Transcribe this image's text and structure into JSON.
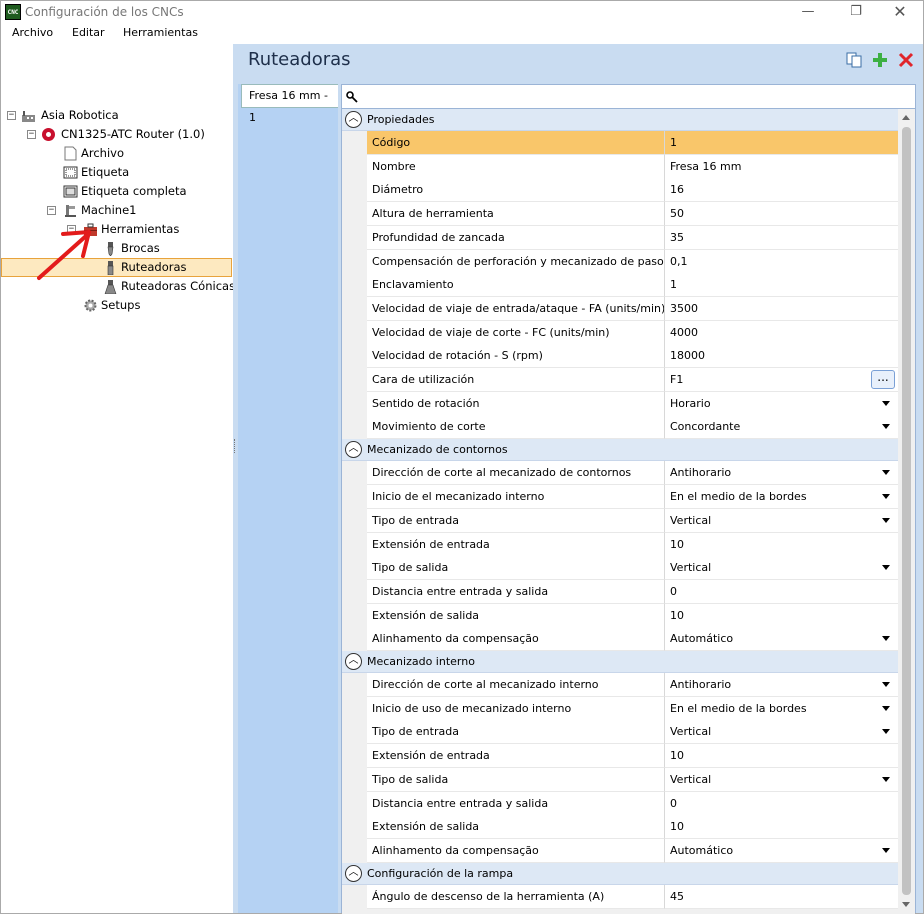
{
  "window": {
    "title": "Configuración de los CNCs",
    "app_icon_text": "CNC"
  },
  "menu": [
    "Archivo",
    "Editar",
    "Herramientas"
  ],
  "tree": [
    {
      "label": "Asia Robotica",
      "expander": "−",
      "icon": "factory-icon"
    },
    {
      "label": "CN1325-ATC Router (1.0)",
      "expander": "−",
      "icon": "router-machine-icon"
    },
    {
      "label": "Archivo",
      "icon": "file-icon"
    },
    {
      "label": "Etiqueta",
      "icon": "label-icon"
    },
    {
      "label": "Etiqueta completa",
      "icon": "label-full-icon"
    },
    {
      "label": "Machine1",
      "expander": "−",
      "icon": "machine-icon"
    },
    {
      "label": "Herramientas",
      "expander": "−",
      "icon": "toolbox-icon"
    },
    {
      "label": "Brocas",
      "icon": "drill-bit-icon"
    },
    {
      "label": "Ruteadoras",
      "icon": "router-bit-icon",
      "selected": true
    },
    {
      "label": "Ruteadoras Cónicas",
      "icon": "conical-bit-icon"
    },
    {
      "label": "Setups",
      "icon": "gear-icon"
    }
  ],
  "main": {
    "title": "Ruteadoras",
    "tab": "Fresa 16 mm - 1"
  },
  "colors": {
    "accent_bg": "#c9dcf1",
    "selection": "#f9c66a",
    "tree_selection": "#fde9c0",
    "add": "#3cb043",
    "delete": "#e0252b",
    "arrow": "#e31b1b"
  },
  "categories": [
    {
      "name": "Propiedades",
      "props": [
        {
          "name": "Código",
          "value": "1",
          "selected": true
        },
        {
          "name": "Nombre",
          "value": "Fresa 16 mm"
        },
        {
          "name": "Diámetro",
          "value": "16"
        },
        {
          "name": "Altura de herramienta",
          "value": "50"
        },
        {
          "name": "Profundidad de zancada",
          "value": "35"
        },
        {
          "name": "Compensación de perforación y mecanizado de paso",
          "value": "0,1"
        },
        {
          "name": "Enclavamiento",
          "value": "1"
        },
        {
          "name": "Velocidad de viaje de entrada/ataque - FA (units/min)",
          "value": "3500"
        },
        {
          "name": "Velocidad de viaje de corte - FC (units/min)",
          "value": "4000"
        },
        {
          "name": "Velocidad de rotación - S (rpm)",
          "value": "18000"
        },
        {
          "name": "Cara de utilización",
          "value": "F1",
          "ellipsis": true
        },
        {
          "name": "Sentido de rotación",
          "value": "Horario",
          "dropdown": true
        },
        {
          "name": "Movimiento de corte",
          "value": "Concordante",
          "dropdown": true
        }
      ]
    },
    {
      "name": "Mecanizado de contornos",
      "props": [
        {
          "name": "Dirección de corte al mecanizado de contornos",
          "value": "Antihorario",
          "dropdown": true
        },
        {
          "name": "Inicio de el mecanizado interno",
          "value": "En el medio de la bordes",
          "dropdown": true
        },
        {
          "name": "Tipo de entrada",
          "value": "Vertical",
          "dropdown": true
        },
        {
          "name": "Extensión de entrada",
          "value": "10"
        },
        {
          "name": "Tipo de salida",
          "value": "Vertical",
          "dropdown": true
        },
        {
          "name": "Distancia entre entrada y salida",
          "value": "0"
        },
        {
          "name": "Extensión de salida",
          "value": "10"
        },
        {
          "name": "Alinhamento da compensação",
          "value": "Automático",
          "dropdown": true
        }
      ]
    },
    {
      "name": "Mecanizado interno",
      "props": [
        {
          "name": "Dirección de corte al mecanizado interno",
          "value": "Antihorario",
          "dropdown": true
        },
        {
          "name": "Inicio de uso de mecanizado interno",
          "value": "En el medio de la bordes",
          "dropdown": true
        },
        {
          "name": "Tipo de entrada",
          "value": "Vertical",
          "dropdown": true
        },
        {
          "name": "Extensión de entrada",
          "value": "10"
        },
        {
          "name": "Tipo de salida",
          "value": "Vertical",
          "dropdown": true
        },
        {
          "name": "Distancia entre entrada y salida",
          "value": "0"
        },
        {
          "name": "Extensión de salida",
          "value": "10"
        },
        {
          "name": "Alinhamento da compensação",
          "value": "Automático",
          "dropdown": true
        }
      ]
    },
    {
      "name": "Configuración de la rampa",
      "props": [
        {
          "name": "Ángulo de descenso de la herramienta (A)",
          "value": "45"
        }
      ]
    }
  ],
  "ellipsis_label": "..."
}
